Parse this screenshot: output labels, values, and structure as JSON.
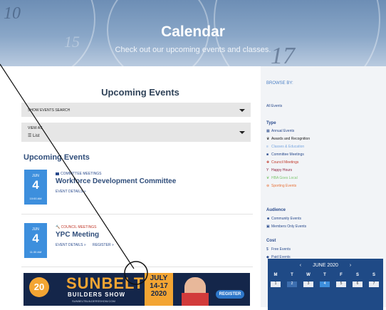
{
  "header": {
    "title": "Calendar",
    "subtitle": "Check out our upcoming events and classes.",
    "bg_numbers": [
      "10",
      "15",
      "17"
    ]
  },
  "main": {
    "heading": "Upcoming Events",
    "search_dropdown": "SHOW EVENTS SEARCH",
    "view_as_label": "VIEW AS",
    "view_as_value": "List",
    "section_heading": "Upcoming Events",
    "events": [
      {
        "month": "JUN",
        "day": "4",
        "time": "10:00 AM",
        "category": "COMMITTEE MEETINGS",
        "title": "Workforce Development Committee",
        "details_label": "EVENT DETAILS »",
        "register_label": ""
      },
      {
        "month": "JUN",
        "day": "4",
        "time": "11:30 AM",
        "category": "COUNCIL MEETINGS",
        "title": "YPC Meeting",
        "details_label": "EVENT DETAILS »",
        "register_label": "REGISTER »"
      }
    ],
    "banner": {
      "badge": "20",
      "title_line1": "SUNBELT",
      "title_line2": "BUILDERS SHOW",
      "url": "SUNBELTBUILDERSSHOW.COM",
      "date_line1": "JULY",
      "date_line2": "14-17",
      "date_line3": "2020",
      "register_label": "REGISTER"
    }
  },
  "sidebar": {
    "browse_by": "BROWSE BY:",
    "all_events": "All Events",
    "type_heading": "Type",
    "types": [
      {
        "label": "Annual Events",
        "icon": "calendar-icon",
        "color": "#2a4b8d"
      },
      {
        "label": "Awards and Recognition",
        "icon": "trophy-icon",
        "color": "#222222"
      },
      {
        "label": "Classes & Education",
        "icon": "book-icon",
        "color": "#7aa7e0"
      },
      {
        "label": "Committee Meetings",
        "icon": "folder-icon",
        "color": "#2a4b8d"
      },
      {
        "label": "Council Meetings",
        "icon": "gavel-icon",
        "color": "#c0392b"
      },
      {
        "label": "Happy Hours",
        "icon": "glass-icon",
        "color": "#8e1f3c"
      },
      {
        "label": "HBA Goes Local",
        "icon": "leaf-icon",
        "color": "#7dc56f"
      },
      {
        "label": "Sporting Events",
        "icon": "ball-icon",
        "color": "#e8743b"
      }
    ],
    "audience_heading": "Audience",
    "audiences": [
      {
        "label": "Community Events",
        "icon": "people-icon"
      },
      {
        "label": "Members Only Events",
        "icon": "lock-icon"
      }
    ],
    "cost_heading": "Cost",
    "costs": [
      {
        "label": "Free Events",
        "icon": "dollar-icon"
      },
      {
        "label": "Paid Events",
        "icon": "tag-icon"
      }
    ],
    "calendar": {
      "prev": "‹",
      "next": "›",
      "month_label": "JUNE 2020",
      "dows": [
        "M",
        "T",
        "W",
        "T",
        "F",
        "S",
        "S"
      ],
      "days": [
        "1",
        "2",
        "3",
        "4",
        "5",
        "6",
        "7"
      ]
    }
  },
  "colors": {
    "accent_blue": "#3d8fdd",
    "navy": "#2f4d7a",
    "calendar_bg": "#1f4a86"
  }
}
